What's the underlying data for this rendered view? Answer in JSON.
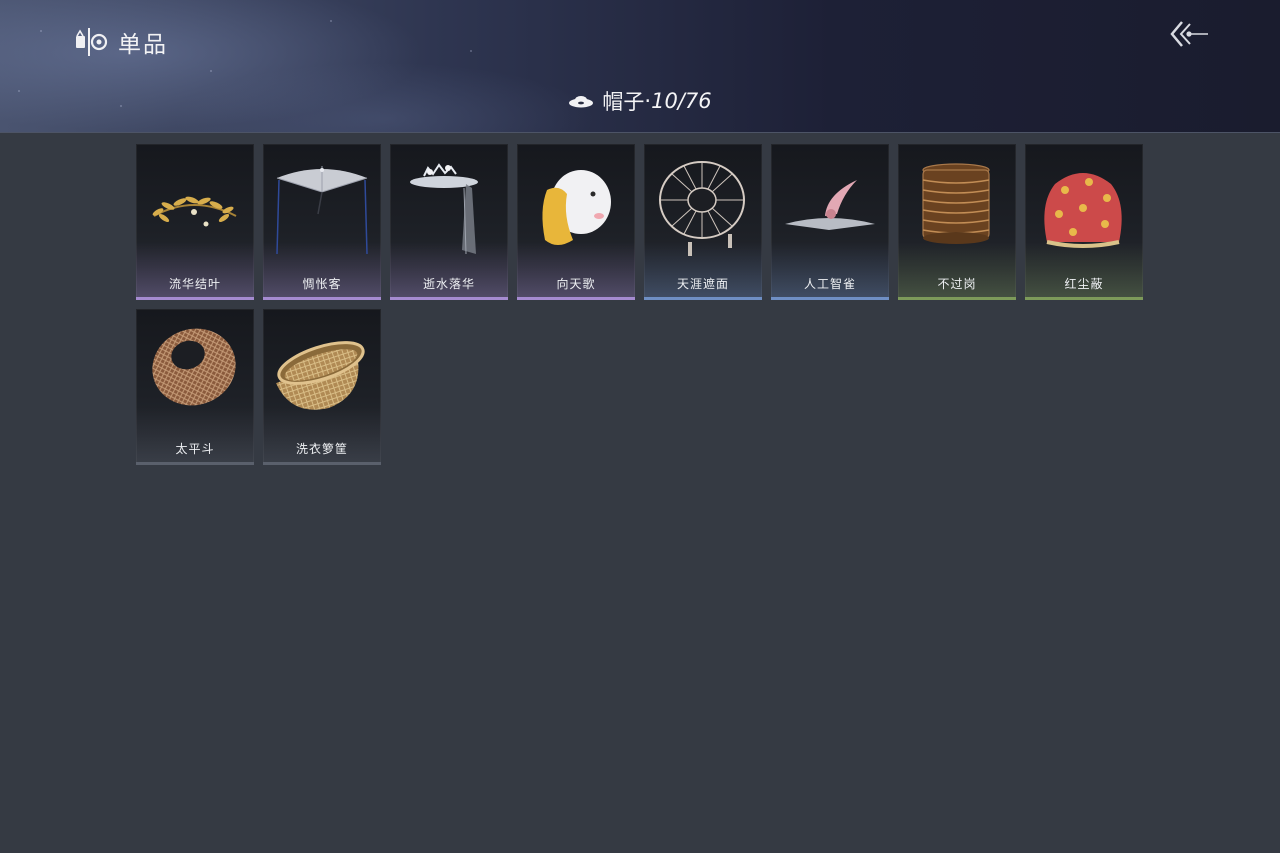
{
  "header": {
    "title": "单品",
    "category_label": "帽子",
    "category_separator": "·",
    "count_text": "10/76"
  },
  "colors": {
    "background": "#353a43",
    "rarity_purple": "#a58bd0",
    "rarity_blue": "#6f8fc4",
    "rarity_green": "#7d9a5a",
    "rarity_gray": "#5a606c"
  },
  "items": [
    {
      "name": "流华结叶",
      "rarity": "purple",
      "icon": "golden-leaf-circlet-icon"
    },
    {
      "name": "惆怅客",
      "rarity": "purple",
      "icon": "veiled-straw-hat-icon"
    },
    {
      "name": "逝水落华",
      "rarity": "purple",
      "icon": "flower-veil-hat-icon"
    },
    {
      "name": "向天歌",
      "rarity": "purple",
      "icon": "goose-hood-icon"
    },
    {
      "name": "天涯遮面",
      "rarity": "blue",
      "icon": "wire-frame-hat-icon"
    },
    {
      "name": "人工智雀",
      "rarity": "blue",
      "icon": "bird-hat-icon"
    },
    {
      "name": "不过岗",
      "rarity": "green",
      "icon": "stacked-bowls-hat-icon"
    },
    {
      "name": "红尘蔽",
      "rarity": "green",
      "icon": "red-floral-hood-icon"
    },
    {
      "name": "太平斗",
      "rarity": "gray",
      "icon": "woven-basket-hat-icon"
    },
    {
      "name": "洗衣箩筐",
      "rarity": "gray",
      "icon": "laundry-basket-icon"
    }
  ]
}
